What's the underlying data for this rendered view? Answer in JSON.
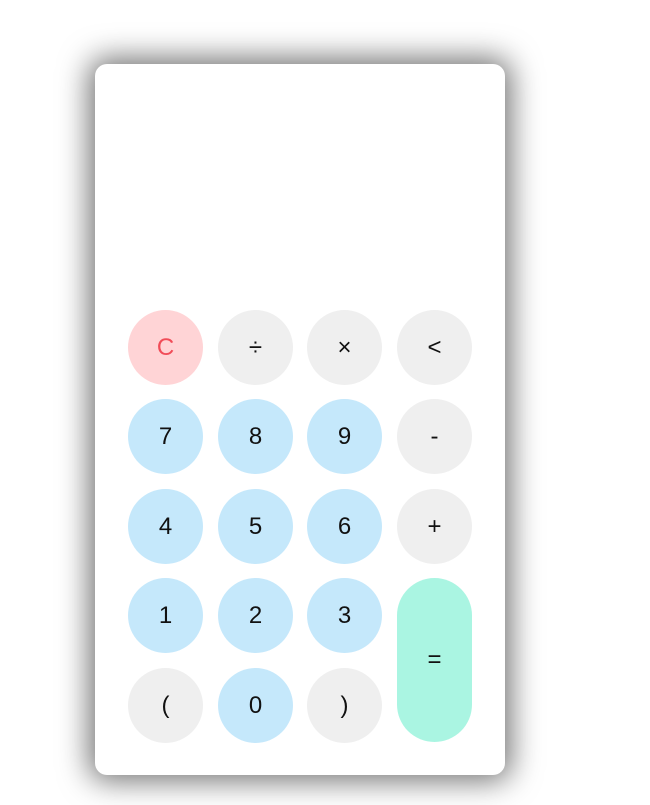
{
  "display": {
    "value": ""
  },
  "keys": {
    "clear": "C",
    "divide": "÷",
    "multiply": "×",
    "backspace": "<",
    "seven": "7",
    "eight": "8",
    "nine": "9",
    "subtract": "-",
    "four": "4",
    "five": "5",
    "six": "6",
    "add": "+",
    "one": "1",
    "two": "2",
    "three": "3",
    "equals": "=",
    "open_paren": "(",
    "zero": "0",
    "close_paren": ")"
  },
  "colors": {
    "clear_bg": "#ffd4d6",
    "clear_text": "#f14c58",
    "operator_bg": "#efefef",
    "digit_bg": "#c5e8fb",
    "equals_bg": "#aaf5e2"
  }
}
